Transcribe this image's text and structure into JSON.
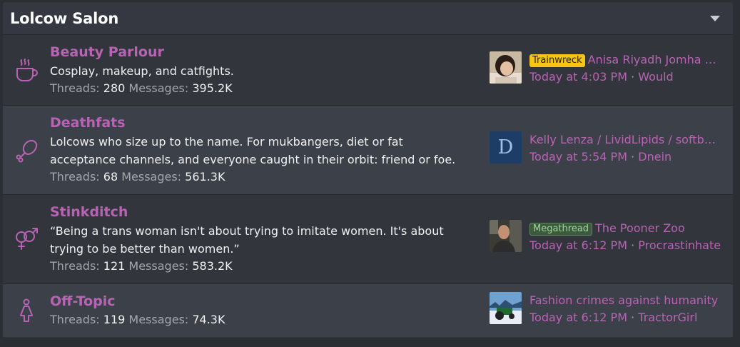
{
  "category": {
    "title": "Lolcow Salon"
  },
  "icons": {
    "accent": "#b864b4"
  },
  "nodes": [
    {
      "icon": "coffee-cup-icon",
      "title": "Beauty Parlour",
      "description_lines": [
        "Cosplay, makeup, and catfights."
      ],
      "threads_label": "Threads:",
      "threads": "280",
      "messages_label": "Messages:",
      "messages": "395.2K",
      "latest": {
        "prefix": "Trainwreck",
        "thread": "Anisa Riyadh Jomha …",
        "time": "Today at 4:03 PM",
        "separator": "·",
        "user": "Would"
      }
    },
    {
      "icon": "drumstick-icon",
      "title": "Deathfats",
      "description_lines": [
        "Lolcows who size up to the name. For mukbangers, diet or fat",
        "acceptance channels, and everyone caught in their orbit: friend or foe."
      ],
      "threads_label": "Threads:",
      "threads": "68",
      "messages_label": "Messages:",
      "messages": "561.3K",
      "latest": {
        "avatar_letter": "D",
        "thread": "Kelly Lenza / LividLipids / softb…",
        "time": "Today at 5:54 PM",
        "separator": "·",
        "user": "Dnein"
      }
    },
    {
      "icon": "gender-symbols-icon",
      "title": "Stinkditch",
      "description_lines": [
        "“Being a trans woman isn't about trying to imitate women. It's about",
        "trying to be better than women.”"
      ],
      "threads_label": "Threads:",
      "threads": "121",
      "messages_label": "Messages:",
      "messages": "583.2K",
      "latest": {
        "prefix": "Megathread",
        "thread": "The Pooner Zoo",
        "time": "Today at 6:12 PM",
        "separator": "·",
        "user": "Procrastinhate"
      }
    },
    {
      "icon": "person-female-icon",
      "title": "Off-Topic",
      "description_lines": [],
      "threads_label": "Threads:",
      "threads": "119",
      "messages_label": "Messages:",
      "messages": "74.3K",
      "latest": {
        "thread": "Fashion crimes against humanity",
        "time": "Today at 6:12 PM",
        "separator": "·",
        "user": "TractorGirl"
      }
    }
  ]
}
